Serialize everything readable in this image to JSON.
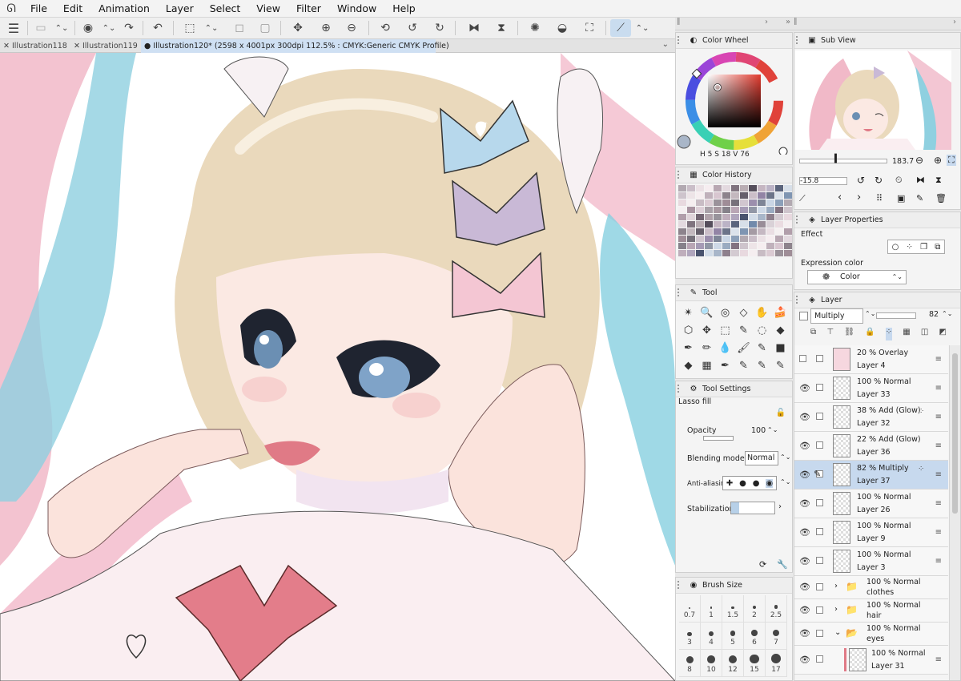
{
  "menubar": {
    "logo": "clip-studio-logo-icon",
    "items": [
      "File",
      "Edit",
      "Animation",
      "Layer",
      "Select",
      "View",
      "Filter",
      "Window",
      "Help"
    ]
  },
  "tabs": [
    {
      "label": "Illustration118",
      "active": false
    },
    {
      "label": "Illustration119",
      "active": false
    },
    {
      "label": "Illustration120* (2598 x 4001px 300dpi 112.5% : CMYK:Generic CMYK Profile)",
      "active": true
    }
  ],
  "color_wheel": {
    "title": "Color Wheel",
    "readout": {
      "h_label": "H",
      "h": "5",
      "s_label": "S",
      "s": "18",
      "v_label": "V",
      "v": "76"
    }
  },
  "color_history": {
    "title": "Color History"
  },
  "tool_panel": {
    "title": "Tool",
    "icons": [
      "auto-select-icon",
      "zoom-icon",
      "lasso-icon",
      "eraser-icon",
      "hand-icon",
      "cake-icon",
      "object-icon",
      "move-icon",
      "select-rect-icon",
      "eyedropper-icon",
      "lasso-select-icon",
      "fill-icon",
      "pen-icon",
      "pencil-icon",
      "blend-icon",
      "brush-icon",
      "airbrush-icon",
      "gradient-icon",
      "eraser2-icon",
      "frame-icon",
      "ruler-icon",
      "pen2-icon",
      "pen3-icon",
      "pen4-icon"
    ],
    "glyphs": [
      "✴",
      "🔍",
      "◎",
      "◇",
      "✋",
      "🍰",
      "⬡",
      "✥",
      "⬚",
      "✎",
      "◌",
      "◆",
      "✒",
      "✏",
      "💧",
      "🖌",
      "✎",
      "■",
      "◆",
      "▦",
      "✒",
      "✎",
      "✎",
      "✎"
    ]
  },
  "tool_settings": {
    "title": "Tool Settings",
    "name": "Lasso fill",
    "opacity_label": "Opacity",
    "opacity": "100",
    "blend_label": "Blending mode",
    "blend": "Normal",
    "aa_label": "Anti-aliasing",
    "stab_label": "Stabilization"
  },
  "brush_size": {
    "title": "Brush Size",
    "sizes": [
      "0.7",
      "1",
      "1.5",
      "2",
      "2.5",
      "3",
      "4",
      "5",
      "6",
      "7",
      "8",
      "10",
      "12",
      "15",
      "17"
    ]
  },
  "sub_view": {
    "title": "Sub View",
    "zoom": "183.7",
    "rotation": "-15.8"
  },
  "layer_properties": {
    "title": "Layer Properties",
    "effect_label": "Effect",
    "expr_label": "Expression color",
    "expr_value": "Color"
  },
  "layer_panel": {
    "title": "Layer",
    "blend": "Multiply",
    "opacity": "82",
    "layers": [
      {
        "mode": "20 % Overlay",
        "name": "Layer 4",
        "visible": false,
        "selected": false,
        "fx": false,
        "thumb": "#f6d7df"
      },
      {
        "mode": "100 % Normal",
        "name": "Layer 33",
        "visible": true,
        "selected": false,
        "fx": false,
        "thumb": ""
      },
      {
        "mode": "38 % Add (Glow)",
        "name": "Layer 32",
        "visible": true,
        "selected": false,
        "fx": true,
        "thumb": ""
      },
      {
        "mode": "22 % Add (Glow)",
        "name": "Layer 36",
        "visible": true,
        "selected": false,
        "fx": false,
        "thumb": ""
      },
      {
        "mode": "82 % Multiply",
        "name": "Layer 37",
        "visible": true,
        "selected": true,
        "fx": true,
        "thumb": ""
      },
      {
        "mode": "100 % Normal",
        "name": "Layer 26",
        "visible": true,
        "selected": false,
        "fx": false,
        "thumb": ""
      },
      {
        "mode": "100 % Normal",
        "name": "Layer 9",
        "visible": true,
        "selected": false,
        "fx": false,
        "thumb": ""
      },
      {
        "mode": "100 % Normal",
        "name": "Layer 3",
        "visible": true,
        "selected": false,
        "fx": false,
        "thumb": ""
      }
    ],
    "folders": [
      {
        "mode": "100 % Normal",
        "name": "clothes"
      },
      {
        "mode": "100 % Normal",
        "name": "hair"
      },
      {
        "mode": "100 % Normal",
        "name": "eyes"
      }
    ],
    "last": {
      "mode": "100 % Normal",
      "name": "Layer 31"
    }
  },
  "colors": {
    "accent": "#c7d9ee",
    "panel": "#f4f4f4",
    "canvas": "#ffffff"
  }
}
